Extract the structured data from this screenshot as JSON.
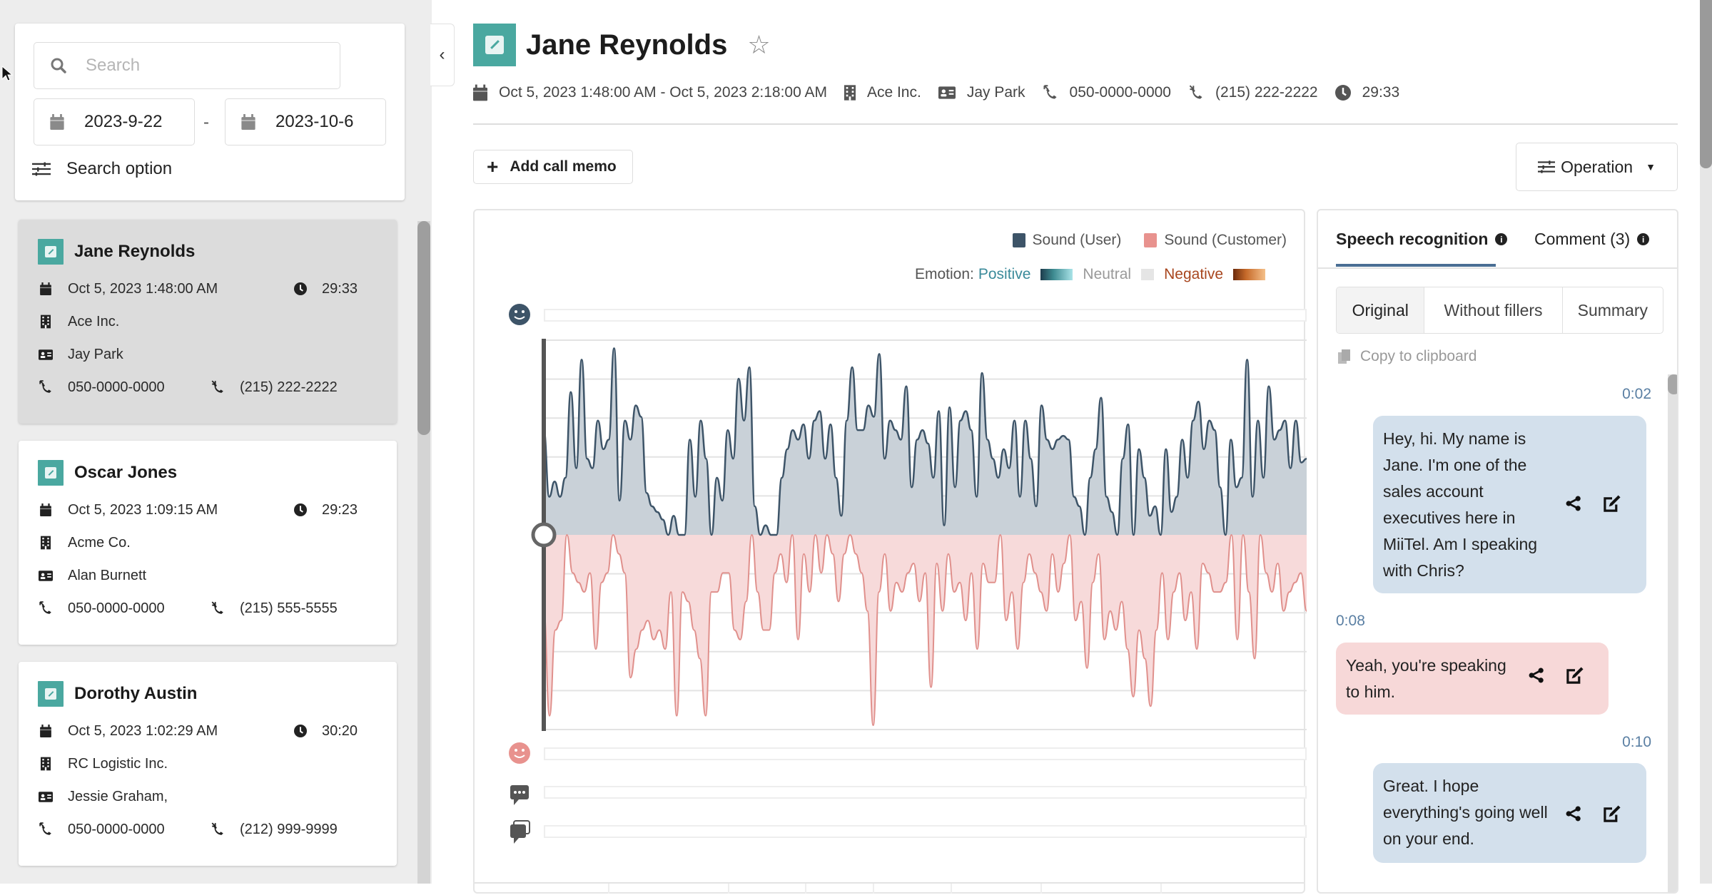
{
  "search": {
    "placeholder": "Search",
    "date_from": "2023-9-22",
    "date_separator": "-",
    "date_to": "2023-10-6",
    "option_label": "Search option"
  },
  "call_list": [
    {
      "name": "Jane Reynolds",
      "datetime": "Oct 5, 2023 1:48:00 AM",
      "duration": "29:33",
      "company": "Ace Inc.",
      "contact": "Jay Park",
      "outgoing_number": "050-0000-0000",
      "incoming_number": "(215) 222-2222",
      "selected": true
    },
    {
      "name": "Oscar Jones",
      "datetime": "Oct 5, 2023 1:09:15 AM",
      "duration": "29:23",
      "company": "Acme Co.",
      "contact": "Alan Burnett",
      "outgoing_number": "050-0000-0000",
      "incoming_number": "(215) 555-5555",
      "selected": false
    },
    {
      "name": "Dorothy Austin",
      "datetime": "Oct 5, 2023 1:02:29 AM",
      "duration": "30:20",
      "company": "RC Logistic Inc.",
      "contact": "Jessie Graham,",
      "outgoing_number": "050-0000-0000",
      "incoming_number": "(212) 999-9999",
      "selected": false
    }
  ],
  "collapse_label": "‹",
  "detail": {
    "title": "Jane Reynolds",
    "star": "☆",
    "time_range": "Oct 5, 2023 1:48:00 AM - Oct 5, 2023 2:18:00 AM",
    "company": "Ace Inc.",
    "contact": "Jay Park",
    "outgoing_number": "050-0000-0000",
    "incoming_number": "(215) 222-2222",
    "duration": "29:33",
    "add_memo_label": "Add call memo",
    "operation_label": "Operation"
  },
  "chart_legend": {
    "user_label": "Sound (User)",
    "customer_label": "Sound (Customer)",
    "emotion_prefix": "Emotion:",
    "positive": "Positive",
    "neutral": "Neutral",
    "negative": "Negative"
  },
  "colors": {
    "user": "#3d5468",
    "user_fill": "#c9d1d8",
    "customer": "#e0908c",
    "customer_fill": "#f7dada",
    "teal": "#4aa8a0",
    "positive_text": "#3a8a9a",
    "negative_text": "#a8461e",
    "timestamp": "#5a7fa3"
  },
  "chart_data": {
    "type": "area",
    "title": "",
    "xlabel": "",
    "ylabel": "",
    "ylim": [
      -1,
      1
    ],
    "grid": true,
    "legend": "top-right",
    "series": [
      {
        "name": "Sound (User)",
        "values": [
          0.55,
          0.2,
          0.28,
          0.2,
          0.3,
          0.75,
          0.35,
          0.92,
          0.4,
          0.35,
          0.6,
          0.45,
          0.5,
          0.98,
          0.18,
          0.6,
          0.5,
          0.68,
          0.62,
          0.22,
          0.15,
          0.12,
          0.08,
          0.0,
          0.1,
          0.0,
          0.0,
          0.5,
          0.2,
          0.6,
          0.4,
          0.0,
          0.3,
          0.18,
          0.55,
          0.4,
          0.82,
          0.6,
          0.88,
          0.15,
          0.0,
          0.05,
          0.0,
          0.0,
          0.3,
          0.45,
          0.55,
          0.5,
          0.58,
          0.4,
          0.6,
          0.65,
          0.4,
          0.58,
          0.3,
          0.1,
          0.6,
          0.88,
          0.55,
          0.55,
          0.68,
          0.62,
          0.95,
          0.4,
          0.6,
          0.55,
          0.5,
          0.78,
          0.25,
          0.5,
          0.55,
          0.48,
          0.3,
          0.65,
          0.05,
          0.67,
          0.25,
          0.6,
          0.65,
          0.55,
          0.2,
          0.85,
          0.5,
          0.4,
          0.3,
          0.45,
          0.35,
          0.6,
          0.2,
          0.6,
          0.4,
          0.15,
          0.68,
          0.5,
          0.45,
          0.5,
          0.52,
          0.5,
          0.2,
          0.15,
          0.0,
          0.3,
          0.45,
          0.72,
          0.2,
          0.12,
          0.0,
          0.4,
          0.58,
          0.0,
          0.45,
          0.3,
          0.1,
          0.15,
          0.0,
          0.45,
          0.12,
          0.2,
          0.5,
          0.3,
          0.6,
          0.7,
          0.45,
          0.6,
          0.55,
          0.25,
          0.0,
          0.5,
          0.25,
          0.3,
          0.92,
          0.2,
          0.6,
          0.3,
          0.78,
          0.5,
          0.55,
          0.6,
          0.35,
          0.6,
          0.38,
          0.4
        ]
      },
      {
        "name": "Sound (Customer)",
        "values": [
          -0.4,
          -0.95,
          -0.5,
          -0.45,
          -0.0,
          -0.2,
          -0.25,
          -0.3,
          -0.2,
          -0.6,
          -0.25,
          -0.2,
          -0.0,
          -0.1,
          -0.2,
          -0.75,
          -0.6,
          -0.5,
          -0.45,
          -0.55,
          -0.5,
          -0.6,
          -0.3,
          -0.95,
          -0.3,
          -0.35,
          -0.5,
          -0.65,
          -0.95,
          -0.3,
          -0.3,
          -0.2,
          -0.2,
          -0.5,
          -0.55,
          -0.35,
          -0.0,
          -0.3,
          -0.5,
          -0.5,
          -0.2,
          -0.1,
          -0.25,
          -0.0,
          -0.55,
          -0.1,
          -0.3,
          -0.0,
          -0.2,
          -0.0,
          -0.1,
          -0.35,
          -0.1,
          -0.0,
          -0.1,
          -0.2,
          -0.4,
          -1.0,
          -0.3,
          -0.1,
          -0.4,
          -0.25,
          -0.3,
          -0.2,
          -0.15,
          -0.35,
          -0.2,
          -0.8,
          -0.15,
          -0.4,
          -0.1,
          -0.3,
          -0.25,
          -0.45,
          -0.2,
          -0.6,
          -0.15,
          -0.25,
          -0.25,
          -0.0,
          -0.45,
          -0.3,
          -0.6,
          -0.25,
          -0.1,
          -0.2,
          -0.3,
          -0.4,
          -0.1,
          -0.3,
          -0.15,
          -0.0,
          -0.45,
          -0.35,
          -0.7,
          -0.25,
          -0.1,
          -0.55,
          -0.4,
          -0.5,
          -0.35,
          -0.6,
          -0.85,
          -0.5,
          -0.65,
          -0.9,
          -0.5,
          -0.2,
          -0.55,
          -0.3,
          -0.2,
          -0.45,
          -0.3,
          -0.6,
          -0.15,
          -0.2,
          -0.3,
          -0.3,
          -0.25,
          -0.0,
          -0.55,
          -0.0,
          -0.3,
          -0.65,
          -0.0,
          -0.2,
          -0.3,
          -0.15,
          -0.4,
          -0.3,
          -0.25,
          -0.2,
          -0.4
        ]
      }
    ],
    "emotion_tracks": [
      "user-emotion",
      "customer-emotion",
      "comments",
      "conversations"
    ]
  },
  "side_panel": {
    "tabs": [
      {
        "label": "Speech recognition",
        "active": true
      },
      {
        "label": "Comment (3)",
        "active": false
      }
    ],
    "modes": [
      {
        "label": "Original",
        "active": true
      },
      {
        "label": "Without fillers",
        "active": false
      },
      {
        "label": "Summary",
        "active": false
      }
    ],
    "copy_label": "Copy to clipboard",
    "messages": [
      {
        "time": "0:02",
        "speaker": "user",
        "text": "Hey, hi. My name is Jane. I'm one of the sales account executives here in MiiTel. Am I speaking with Chris?"
      },
      {
        "time": "0:08",
        "speaker": "customer",
        "text": "Yeah, you're speaking to him."
      },
      {
        "time": "0:10",
        "speaker": "user",
        "text": "Great. I hope everything's going well on your end."
      }
    ]
  }
}
